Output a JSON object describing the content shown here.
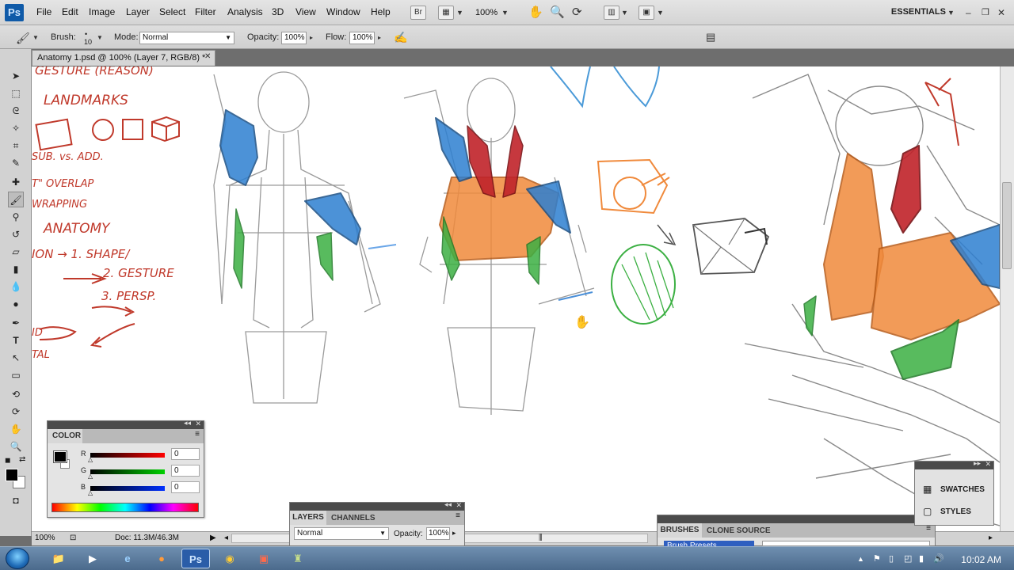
{
  "app": {
    "logo": "Ps"
  },
  "menu": [
    "File",
    "Edit",
    "Image",
    "Layer",
    "Select",
    "Filter",
    "Analysis",
    "3D",
    "View",
    "Window",
    "Help"
  ],
  "menubar": {
    "bridge": "Br",
    "zoom": "100%",
    "workspace": "ESSENTIALS"
  },
  "options": {
    "brush_label": "Brush:",
    "brush_size": "10",
    "mode_label": "Mode:",
    "mode_value": "Normal",
    "opacity_label": "Opacity:",
    "opacity_value": "100%",
    "flow_label": "Flow:",
    "flow_value": "100%"
  },
  "document": {
    "tab_title": "Anatomy 1.psd @ 100% (Layer 7, RGB/8) *"
  },
  "canvas_text": {
    "l1": "GESTURE (REASON)",
    "l2": "LANDMARKS",
    "l3": "SUB. vs. ADD.",
    "l4": "T\" OVERLAP",
    "l5": "WRAPPING",
    "l6": "ANATOMY",
    "l7": "ION → 1. SHAPE/",
    "l8": "2. GESTURE",
    "l9": "3. PERSP.",
    "l10": "ID",
    "l11": "TAL"
  },
  "status": {
    "zoom": "100%",
    "doc": "Doc: 11.3M/46.3M"
  },
  "color_panel": {
    "title": "COLOR",
    "channels": [
      {
        "label": "R",
        "value": "0",
        "color": "#e01010"
      },
      {
        "label": "G",
        "value": "0",
        "color": "#10b010"
      },
      {
        "label": "B",
        "value": "0",
        "color": "#1030e0"
      }
    ]
  },
  "layers_panel": {
    "tabs": [
      "LAYERS",
      "CHANNELS"
    ],
    "blend_mode": "Normal",
    "opacity_label": "Opacity:",
    "opacity_value": "100%"
  },
  "brushes_panel": {
    "tabs": [
      "BRUSHES",
      "CLONE SOURCE"
    ],
    "preset": "Brush Presets"
  },
  "side_panels": {
    "swatches": "SWATCHES",
    "styles": "STYLES"
  },
  "taskbar": {
    "clock": "10:02 AM",
    "ps_app": "Ps"
  }
}
